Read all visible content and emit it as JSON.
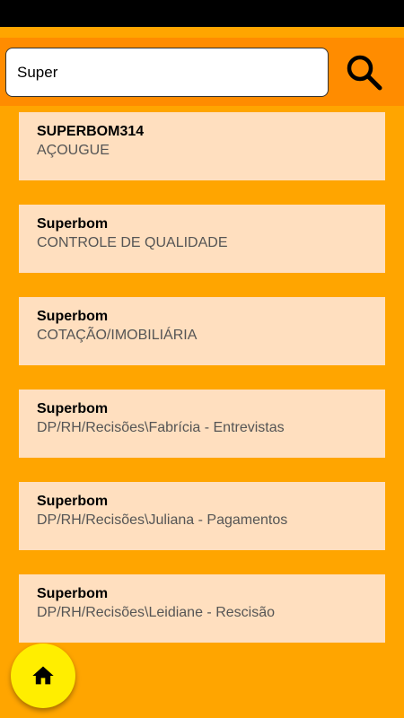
{
  "search": {
    "value": "Super",
    "button_icon": "search-icon"
  },
  "results": [
    {
      "title": "SUPERBOM314",
      "subtitle": "AÇOUGUE"
    },
    {
      "title": "Superbom",
      "subtitle": "CONTROLE DE QUALIDADE"
    },
    {
      "title": "Superbom",
      "subtitle": "COTAÇÃO/IMOBILIÁRIA"
    },
    {
      "title": "Superbom",
      "subtitle": "DP/RH/Recisões\\Fabrícia - Entrevistas"
    },
    {
      "title": "Superbom",
      "subtitle": "DP/RH/Recisões\\Juliana - Pagamentos"
    },
    {
      "title": "Superbom",
      "subtitle": "DP/RH/Recisões\\Leidiane - Rescisão"
    }
  ],
  "fab": {
    "icon": "home-icon"
  },
  "colors": {
    "background": "#FFA500",
    "search_bar": "#FF8C00",
    "card": "#FFDFBF",
    "fab": "#FFEE00"
  }
}
